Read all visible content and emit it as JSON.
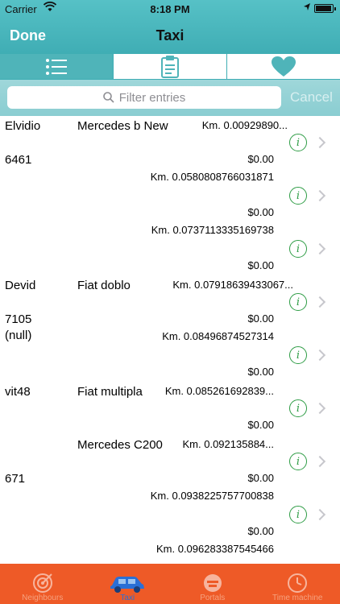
{
  "status": {
    "carrier": "Carrier",
    "time": "8:18 PM"
  },
  "nav": {
    "done_label": "Done",
    "title": "Taxi"
  },
  "segments": [
    {
      "icon": "list-icon"
    },
    {
      "icon": "clipboard-icon"
    },
    {
      "icon": "heart-icon"
    }
  ],
  "search": {
    "placeholder": "Filter entries",
    "cancel_label": "Cancel"
  },
  "entries": {
    "r1": {
      "name": "Elvidio",
      "model": "Mercedes b New",
      "dist": "Km. 0.00929890...",
      "plate": "6461",
      "price": "$0.00"
    },
    "d2": {
      "dist": "Km. 0.0580808766031871",
      "price": "$0.00"
    },
    "d3": {
      "dist": "Km. 0.0737113335169738",
      "price": "$0.00"
    },
    "r4": {
      "name": "Devid",
      "model": "Fiat doblo",
      "dist": "Km. 0.07918639433067...",
      "plate": "7105",
      "price": "$0.00",
      "extra": "(null)"
    },
    "d5": {
      "dist": "Km. 0.08496874527314",
      "price": "$0.00"
    },
    "r6": {
      "name": "vit48",
      "model": "Fiat multipla",
      "dist": "Km. 0.085261692839...",
      "price": "$0.00"
    },
    "r7": {
      "model": "Mercedes C200",
      "dist": "Km. 0.092135884...",
      "plate": "671",
      "price": "$0.00"
    },
    "d8": {
      "dist": "Km. 0.0938225757700838",
      "price": "$0.00"
    },
    "d9": {
      "dist": "Km. 0.096283387545466"
    }
  },
  "tabs": [
    {
      "label": "Neighbours",
      "icon": "target-icon"
    },
    {
      "label": "Taxi",
      "icon": "taxi-icon"
    },
    {
      "label": "Portals",
      "icon": "portal-icon"
    },
    {
      "label": "Time machine",
      "icon": "clock-icon"
    }
  ],
  "colors": {
    "nav": "#4fb4b9",
    "tabbar": "#ee5a27",
    "info": "#2e9c45",
    "active_tab": "#2a6fd6"
  }
}
